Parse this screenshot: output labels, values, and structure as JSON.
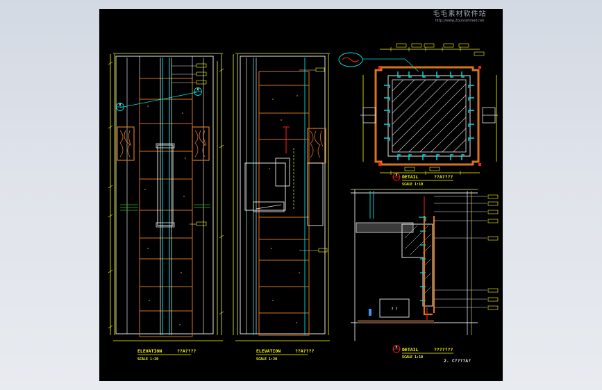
{
  "watermark": {
    "line1": "毛毛素材软件站",
    "line2": "http://www.2bunrahmed.net"
  },
  "drawing": {
    "elevation_left": {
      "title": "ELEVATION",
      "ref": "??A????",
      "scale": "SCALE  1:20"
    },
    "elevation_mid": {
      "title": "ELEVATION",
      "ref": "??A????",
      "scale": "SCALE  1:20"
    },
    "detail_a": {
      "marker": "A",
      "title": "DETAIL",
      "ref": "??A????",
      "scale": "SCALE  1:10"
    },
    "detail_b": {
      "marker": "B",
      "title": "DETAIL",
      "ref": "???????",
      "scale": "SCALE  1:10"
    },
    "sheet_note": "2. C????A?",
    "section_markers": [
      "A",
      "B"
    ]
  },
  "colors": {
    "background": "#000000",
    "line_white": "#e6e6e6",
    "line_yellow": "#ffff00",
    "line_orange": "#d8741e",
    "line_cyan": "#00e0e0",
    "line_red": "#ff2020",
    "line_green": "#22c000",
    "line_blue": "#3399ff"
  }
}
